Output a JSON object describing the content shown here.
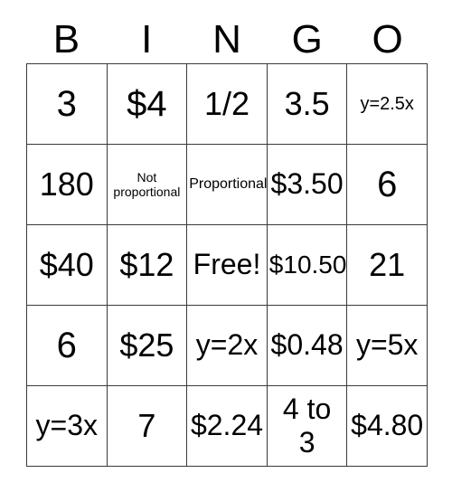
{
  "card": {
    "title_letters": [
      "B",
      "I",
      "N",
      "G",
      "O"
    ],
    "grid_line_color": "#3a3a3a",
    "background_color": "#ffffff",
    "text_color": "#000000",
    "rows": 5,
    "columns": 5,
    "free_space": {
      "row": 3,
      "column": 3,
      "label": "Free!"
    },
    "cells": [
      [
        {
          "text": "3",
          "size": "fs-xl"
        },
        {
          "text": "$4",
          "size": "fs-xl"
        },
        {
          "text": "1/2",
          "size": "fs-lg"
        },
        {
          "text": "3.5",
          "size": "fs-lg"
        },
        {
          "text": "y=2.5x",
          "size": "fs-xs"
        }
      ],
      [
        {
          "text": "180",
          "size": "fs-lg"
        },
        {
          "text": "Not\nproportional",
          "size": "fs-tiny"
        },
        {
          "text": "Proportional",
          "size": "fs-xxs"
        },
        {
          "text": "$3.50",
          "size": "fs-md"
        },
        {
          "text": "6",
          "size": "fs-xl"
        }
      ],
      [
        {
          "text": "$40",
          "size": "fs-lg"
        },
        {
          "text": "$12",
          "size": "fs-lg"
        },
        {
          "text": "Free!",
          "size": "fs-md"
        },
        {
          "text": "$10.50",
          "size": "fs-sm"
        },
        {
          "text": "21",
          "size": "fs-lg"
        }
      ],
      [
        {
          "text": "6",
          "size": "fs-xl"
        },
        {
          "text": "$25",
          "size": "fs-lg"
        },
        {
          "text": "y=2x",
          "size": "fs-md"
        },
        {
          "text": "$0.48",
          "size": "fs-md"
        },
        {
          "text": "y=5x",
          "size": "fs-md"
        }
      ],
      [
        {
          "text": "y=3x",
          "size": "fs-md"
        },
        {
          "text": "7",
          "size": "fs-lg"
        },
        {
          "text": "$2.24",
          "size": "fs-md"
        },
        {
          "text": "4 to\n3",
          "size": "fs-md"
        },
        {
          "text": "$4.80",
          "size": "fs-md"
        }
      ]
    ]
  }
}
